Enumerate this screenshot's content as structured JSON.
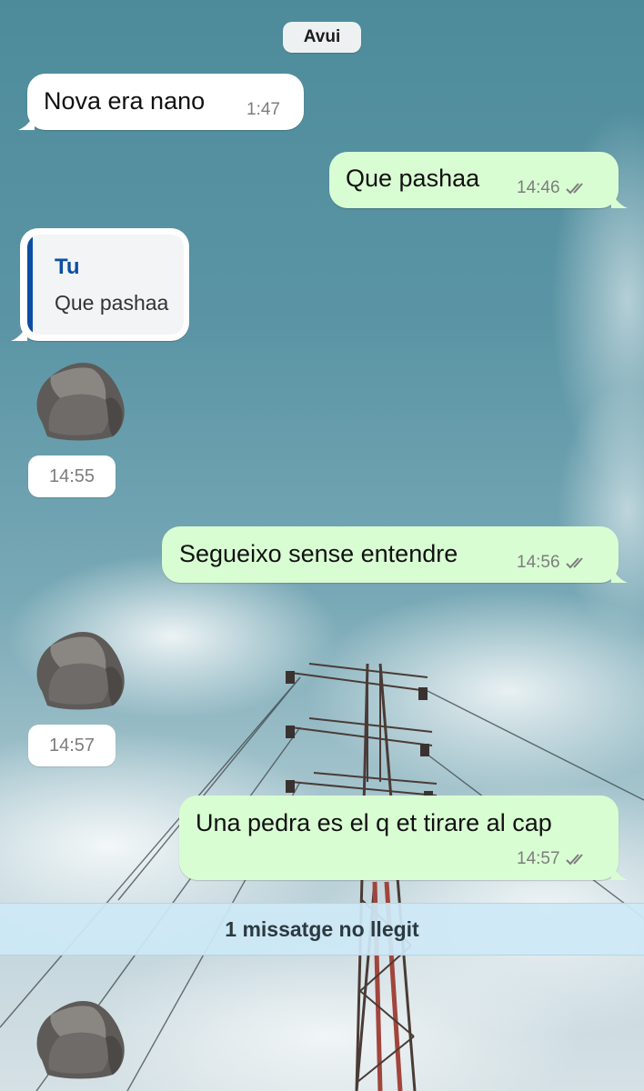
{
  "chat": {
    "date_label": "Avui",
    "messages": [
      {
        "direction": "incoming",
        "text": "Nova era nano",
        "time": "1:47"
      },
      {
        "direction": "outgoing",
        "text": "Que pashaa",
        "time": "14:46",
        "status": "read"
      },
      {
        "direction": "incoming",
        "reply_to": {
          "author": "Tu",
          "text": "Que pashaa"
        }
      },
      {
        "direction": "incoming",
        "sticker": "rock-sticker",
        "time": "14:55"
      },
      {
        "direction": "outgoing",
        "text": "Segueixo sense entendre",
        "time": "14:56",
        "status": "read"
      },
      {
        "direction": "incoming",
        "sticker": "rock-sticker",
        "time": "14:57"
      },
      {
        "direction": "outgoing",
        "text": "Una pedra es el q et tirare al cap",
        "time": "14:57",
        "status": "read"
      },
      {
        "direction": "incoming",
        "sticker": "rock-sticker"
      }
    ],
    "unread_banner": "1 missatge no llegit"
  },
  "icons": {
    "read_status": "double-check-icon",
    "sticker": "rock-sticker"
  },
  "colors": {
    "incoming_bubble": "#ffffff",
    "outgoing_bubble": "#d9fdd3",
    "quote_accent": "#0b4ea2",
    "unread_banner": "#cde8f6",
    "sky": "#5b95a5"
  }
}
